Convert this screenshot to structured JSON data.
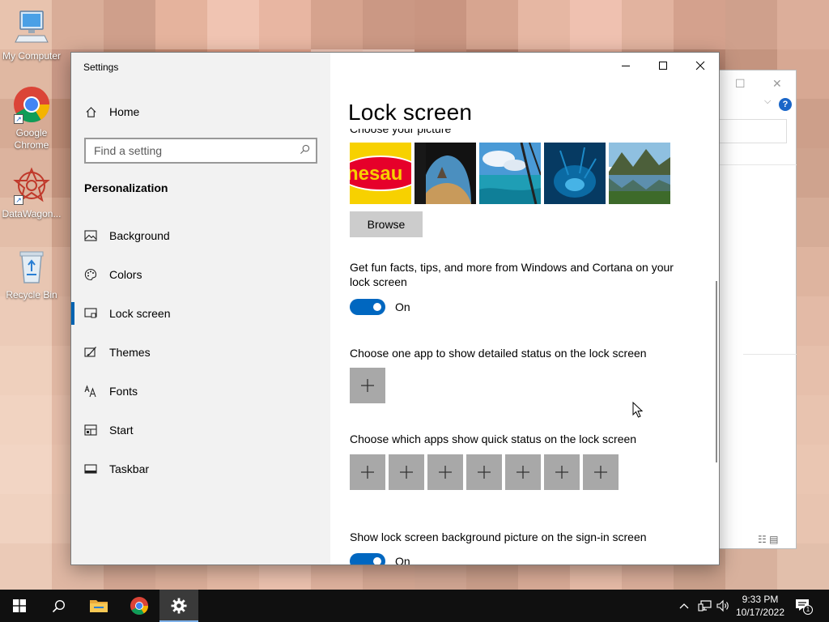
{
  "desktop": {
    "mosaic_colors": [
      "#e8c3ae",
      "#d9ad98",
      "#cf9f8b",
      "#e5b39d",
      "#f0c4b2",
      "#e8b6a2",
      "#d6a38e",
      "#cb9884",
      "#c99581",
      "#d7a590",
      "#e6b7a3",
      "#efc1b0",
      "#e2b39f",
      "#d4a18d",
      "#cfa08c",
      "#dcae9a",
      "#e0b8a2",
      "#c99886",
      "#b9876f",
      "#c78b72",
      "#d9987f",
      "#e2a38c",
      "#f2c9b9",
      "#f4d0c2",
      "#c38a76",
      "#b57e6a",
      "#d29c88",
      "#e0ab97",
      "#c89682",
      "#b98672",
      "#c4947f",
      "#d7a893",
      "#d6ab95",
      "#bb8a74",
      "#a46f58",
      "#b27660",
      "#c4846c",
      "#d69680",
      "#e8b4a1",
      "#f0c1b0",
      "#b57c69",
      "#a26b59",
      "#bf8974",
      "#d39e8a",
      "#b58370",
      "#a5725f",
      "#b78874",
      "#cd9f8a",
      "#dcb39e",
      "#c3937d",
      "#ad7a63",
      "#b7806a",
      "#c78d76",
      "#d89f89",
      "#e3ae9b",
      "#e9b8a6",
      "#b98370",
      "#a8735f",
      "#c18d78",
      "#d6a28d",
      "#bb8a76",
      "#aa7865",
      "#bb8c78",
      "#cfa38e",
      "#e3bea9",
      "#cfa28c",
      "#bd8c76",
      "#c8957f",
      "#d7a48e",
      "#e2b09b",
      "#dca894",
      "#d39f8b",
      "#c18f7b",
      "#b5826e",
      "#c9957f",
      "#dba893",
      "#c69683",
      "#b58571",
      "#c59a86",
      "#d6ac97",
      "#e8c6b2",
      "#d9ae99",
      "#c99a85",
      "#d4a28c",
      "#dfae98",
      "#e7b8a3",
      "#d6a591",
      "#c99985",
      "#c69481",
      "#bc8b78",
      "#cf9d89",
      "#e1af9a",
      "#d0a08c",
      "#bf907c",
      "#cea38f",
      "#deb49f",
      "#eccbb8",
      "#ddb39e",
      "#cfa08b",
      "#d9a792",
      "#e4b39d",
      "#ecbda8",
      "#d8a894",
      "#cb9b87",
      "#caa08d",
      "#c3957f",
      "#d5a48f",
      "#e6b5a0",
      "#d6a792",
      "#c69784",
      "#d5ab97",
      "#e3baa6",
      "#efd0bd",
      "#e2b9a4",
      "#d4a792",
      "#ddad98",
      "#e8b8a3",
      "#efc1ad",
      "#dcad99",
      "#d0a08c",
      "#cfa491",
      "#c99b86",
      "#d9a994",
      "#e9b9a4",
      "#dbad98",
      "#cb9d89",
      "#d9b09c",
      "#e6bfab",
      "#f1d3c1",
      "#e5bda9",
      "#d8ab97",
      "#e0b19c",
      "#eabca7",
      "#f1c5b1",
      "#dfb19d",
      "#d3a590",
      "#d3a895",
      "#cda08b",
      "#dcad98",
      "#ebbda8",
      "#deb19c",
      "#cfa18d",
      "#dcb4a0",
      "#e8c3af",
      "#f2d5c4",
      "#e7c0ac",
      "#dbae9a",
      "#e2b4a0",
      "#ecbfab",
      "#f2c8b5",
      "#e2b5a1",
      "#d6a994",
      "#d6ac99",
      "#d0a48f",
      "#dfb09c",
      "#ecc0ac",
      "#e0b4a0",
      "#d2a591",
      "#dfb8a4",
      "#eac6b2",
      "#f0d2c0",
      "#e5bfab",
      "#d9ad99",
      "#e0b39f",
      "#e9bea9",
      "#efc6b2",
      "#e3b6a2",
      "#d9ac98",
      "#d4aa97",
      "#cfa38e",
      "#ddaf9b",
      "#eabfab",
      "#deb29e",
      "#d0a48f",
      "#ddb6a2",
      "#e8c4b0",
      "#ebcab7",
      "#dfb7a3",
      "#d3a692",
      "#daad98",
      "#e3b7a2",
      "#eac0ad",
      "#ddb09c",
      "#d2a591",
      "#cfa491",
      "#c99d89",
      "#d7a995",
      "#e4b9a5",
      "#d8ac98",
      "#caa08b",
      "#d8b19d",
      "#e2bfab"
    ],
    "icons": [
      {
        "label": "My Computer",
        "icon": "computer-icon"
      },
      {
        "label": "Google Chrome",
        "icon": "chrome-icon"
      },
      {
        "label": "DataWagon...",
        "icon": "datawagon-icon"
      },
      {
        "label": "Recycle Bin",
        "icon": "recycle-bin-icon"
      }
    ]
  },
  "settings": {
    "window_title": "Settings",
    "home_label": "Home",
    "search_placeholder": "Find a setting",
    "section_title": "Personalization",
    "nav": [
      {
        "label": "Background",
        "icon": "image-icon",
        "active": false
      },
      {
        "label": "Colors",
        "icon": "palette-icon",
        "active": false
      },
      {
        "label": "Lock screen",
        "icon": "lock-screen-icon",
        "active": true
      },
      {
        "label": "Themes",
        "icon": "brush-icon",
        "active": false
      },
      {
        "label": "Fonts",
        "icon": "font-icon",
        "active": false
      },
      {
        "label": "Start",
        "icon": "start-icon",
        "active": false
      },
      {
        "label": "Taskbar",
        "icon": "taskbar-icon",
        "active": false
      }
    ],
    "page_title": "Lock screen",
    "choose_picture_label": "Choose your picture",
    "browse_label": "Browse",
    "fun_facts_label": "Get fun facts, tips, and more from Windows and Cortana on your lock screen",
    "fun_facts_state": "On",
    "detailed_status_label": "Choose one app to show detailed status on the lock screen",
    "quick_status_label": "Choose which apps show quick status on the lock screen",
    "quick_status_slots": 7,
    "signin_label": "Show lock screen background picture on the sign-in screen",
    "signin_state": "On",
    "thumb_text": "nesau"
  },
  "colors": {
    "accent": "#0067c0",
    "active_bar": "#0063b1",
    "sidebar_bg": "#f2f2f2",
    "placeholder_tile": "#a8a8a8",
    "taskbar": "#101010"
  },
  "taskbar": {
    "buttons": [
      {
        "name": "start-button",
        "icon": "windows-logo-icon"
      },
      {
        "name": "search-button",
        "icon": "search-icon"
      },
      {
        "name": "file-explorer-button",
        "icon": "folder-icon"
      },
      {
        "name": "chrome-taskbar-button",
        "icon": "chrome-icon"
      },
      {
        "name": "settings-taskbar-button",
        "icon": "gear-icon"
      }
    ],
    "time": "9:33 PM",
    "date": "10/17/2022",
    "notification_count": "1"
  }
}
